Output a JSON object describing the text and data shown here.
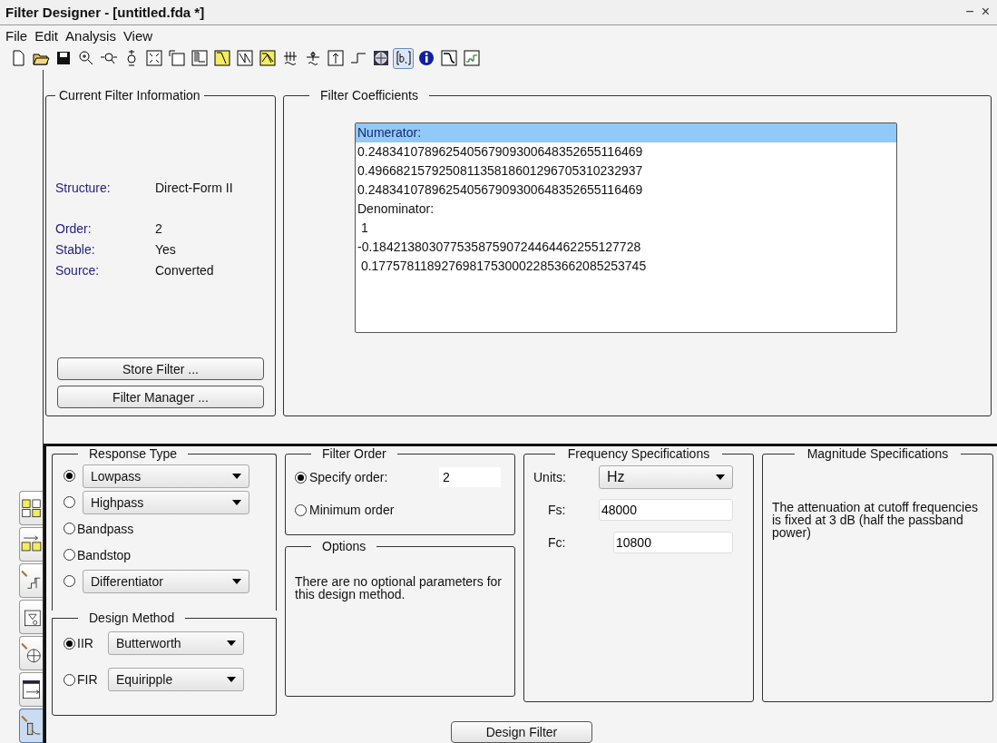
{
  "window": {
    "title": "Filter Designer - [untitled.fda *]",
    "controls": [
      "−",
      "×"
    ]
  },
  "menu": [
    "File",
    "Edit",
    "Analysis",
    "View"
  ],
  "toolbar": [
    {
      "kind": "new",
      "selected": false
    },
    {
      "kind": "open",
      "selected": false
    },
    {
      "kind": "save",
      "selected": false
    },
    {
      "kind": "zoom",
      "selected": false
    },
    {
      "kind": "zoomx",
      "selected": false
    },
    {
      "kind": "zoomy",
      "selected": false
    },
    {
      "kind": "fullview",
      "selected": false
    },
    {
      "kind": "window",
      "selected": false
    },
    {
      "kind": "magnitude",
      "selected": false
    },
    {
      "kind": "magyellow",
      "selected": false
    },
    {
      "kind": "phase",
      "selected": false
    },
    {
      "kind": "magphase",
      "selected": false
    },
    {
      "kind": "groupdelay",
      "selected": false
    },
    {
      "kind": "phasedelay",
      "selected": false
    },
    {
      "kind": "impulse",
      "selected": false
    },
    {
      "kind": "step",
      "selected": false
    },
    {
      "kind": "polezero",
      "selected": false
    },
    {
      "kind": "coeffs",
      "selected": true
    },
    {
      "kind": "info",
      "selected": false
    },
    {
      "kind": "magest",
      "selected": false
    },
    {
      "kind": "noise",
      "selected": false
    }
  ],
  "current_filter_information": {
    "title": "Current Filter Information",
    "fields": [
      {
        "label": "Structure:",
        "value": "Direct-Form II"
      },
      {
        "label": "Order:",
        "value": "2"
      },
      {
        "label": "Stable:",
        "value": "Yes"
      },
      {
        "label": "Source:",
        "value": "Converted"
      }
    ],
    "buttons": [
      "Store Filter ...",
      "Filter Manager ..."
    ]
  },
  "filter_coefficients": {
    "title": "Filter Coefficients",
    "lines": [
      {
        "text": "Numerator:",
        "selected": true
      },
      {
        "text": "0.248341078962540567909300648352655116469",
        "selected": false
      },
      {
        "text": "0.496682157925081135818601296705310232937",
        "selected": false
      },
      {
        "text": "0.248341078962540567909300648352655116469",
        "selected": false
      },
      {
        "text": "Denominator:",
        "selected": false
      },
      {
        "text": " 1",
        "selected": false
      },
      {
        "text": "-0.18421380307753587590724464462255127728",
        "selected": false
      },
      {
        "text": " 0.177578118927698175300022853662085253745",
        "selected": false
      }
    ]
  },
  "sidebar": [
    {
      "kind": "transform",
      "selected": false
    },
    {
      "kind": "convert",
      "selected": false
    },
    {
      "kind": "quantize",
      "selected": false
    },
    {
      "kind": "realize",
      "selected": false
    },
    {
      "kind": "polezero",
      "selected": false
    },
    {
      "kind": "import",
      "selected": false
    },
    {
      "kind": "design",
      "selected": true
    }
  ],
  "response_type": {
    "title": "Response Type",
    "options": [
      {
        "kind": "dropdown",
        "label": "Lowpass",
        "selected": true
      },
      {
        "kind": "dropdown",
        "label": "Highpass",
        "selected": false
      },
      {
        "kind": "label",
        "label": "Bandpass",
        "selected": false
      },
      {
        "kind": "label",
        "label": "Bandstop",
        "selected": false
      },
      {
        "kind": "dropdown",
        "label": "Differentiator",
        "selected": false
      }
    ]
  },
  "design_method": {
    "title": "Design Method",
    "options": [
      {
        "label": "IIR",
        "value": "Butterworth",
        "selected": true
      },
      {
        "label": "FIR",
        "value": "Equiripple",
        "selected": false
      }
    ]
  },
  "filter_order": {
    "title": "Filter Order",
    "options": [
      {
        "label": "Specify order:",
        "value": "2",
        "selected": true
      },
      {
        "label": "Minimum order",
        "selected": false
      }
    ]
  },
  "options": {
    "title": "Options",
    "text": "There are no optional parameters for this design method."
  },
  "frequency_specifications": {
    "title": "Frequency Specifications",
    "units": {
      "label": "Units:",
      "value": "Hz"
    },
    "fields": [
      {
        "label": "Fs:",
        "value": "48000"
      },
      {
        "label": "Fc:",
        "value": "10800"
      }
    ]
  },
  "magnitude_specifications": {
    "title": "Magnitude Specifications",
    "text": "The attenuation at cutoff frequencies is fixed at 3 dB (half the passband power)"
  },
  "design_button": "Design Filter"
}
